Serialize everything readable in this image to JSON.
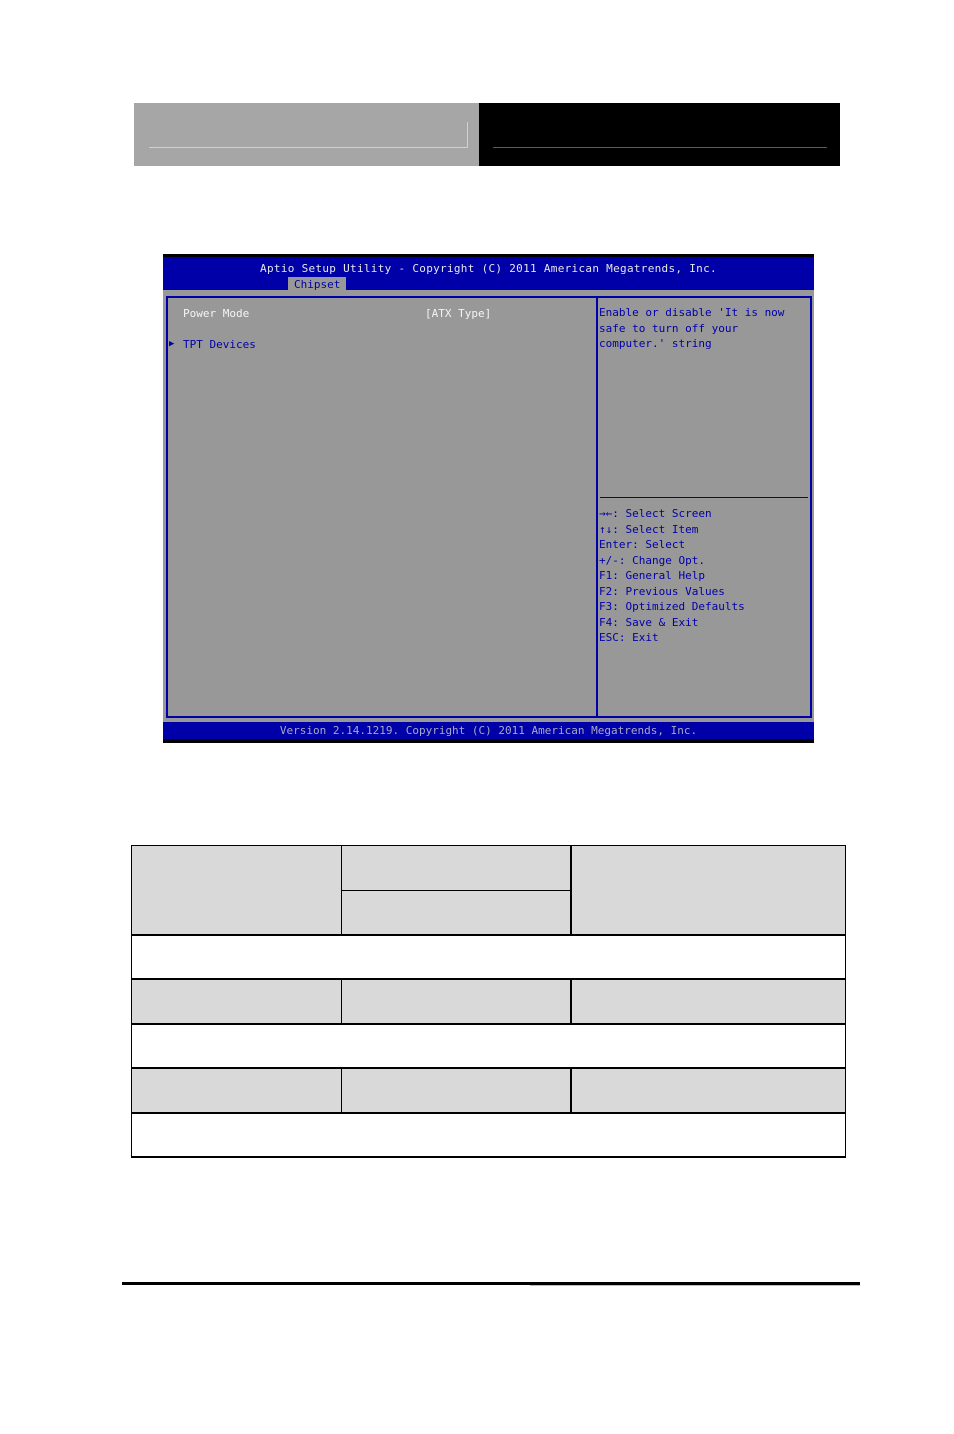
{
  "bios": {
    "title": "Aptio Setup Utility - Copyright (C) 2011 American Megatrends, Inc.",
    "active_tab": "Chipset",
    "items": [
      {
        "label": "Power Mode",
        "value": "[ATX Type]"
      },
      {
        "label": "TPT Devices",
        "submenu": true
      }
    ],
    "help_text": "Enable or disable 'It is now safe to turn off your computer.' string",
    "keys": [
      "→←: Select Screen",
      "↑↓: Select Item",
      "Enter: Select",
      "+/-: Change Opt.",
      "F1: General Help",
      "F2: Previous Values",
      "F3: Optimized Defaults",
      "F4: Save & Exit",
      "ESC: Exit"
    ],
    "footer": "Version 2.14.1219. Copyright (C) 2011 American Megatrends, Inc.",
    "colors": {
      "accent": "#0000a8",
      "background": "#989898"
    }
  },
  "table": {
    "rows": [
      {
        "cells": [
          "",
          "",
          "",
          ""
        ]
      },
      {
        "cells": [
          ""
        ]
      },
      {
        "cells": [
          "",
          "",
          ""
        ]
      },
      {
        "cells": [
          ""
        ]
      },
      {
        "cells": [
          "",
          "",
          ""
        ]
      },
      {
        "cells": [
          ""
        ]
      }
    ]
  }
}
